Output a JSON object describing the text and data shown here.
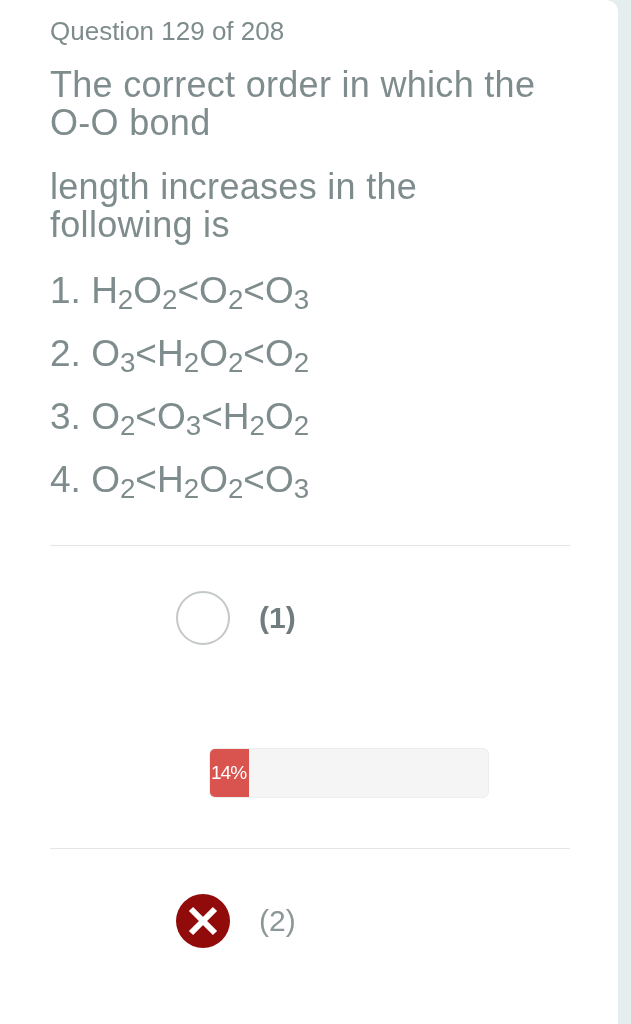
{
  "header": {
    "counter": "Question 129 of 208"
  },
  "question": {
    "paragraphs": [
      "The correct order in which the O-O bond",
      "length increases in the following is"
    ],
    "choices": [
      "1. H$_{2}$O$_{2}$<O$_{2}$<O$_{3}$",
      "2. O$_{3}$<H$_{2}$O$_{2}$<O$_{2}$",
      "3. O$_{2}$<O$_{3}$<H$_{2}$O$_{2}$",
      "4. O$_{2}$<H$_{2}$O$_{2}$<O$_{3}$"
    ]
  },
  "answers": [
    {
      "label": "(1)",
      "selected": false,
      "correct": true,
      "result": {
        "level": 0.14,
        "reading": "14%"
      }
    },
    {
      "label": "(2)",
      "selected": true,
      "correct": false
    }
  ]
}
